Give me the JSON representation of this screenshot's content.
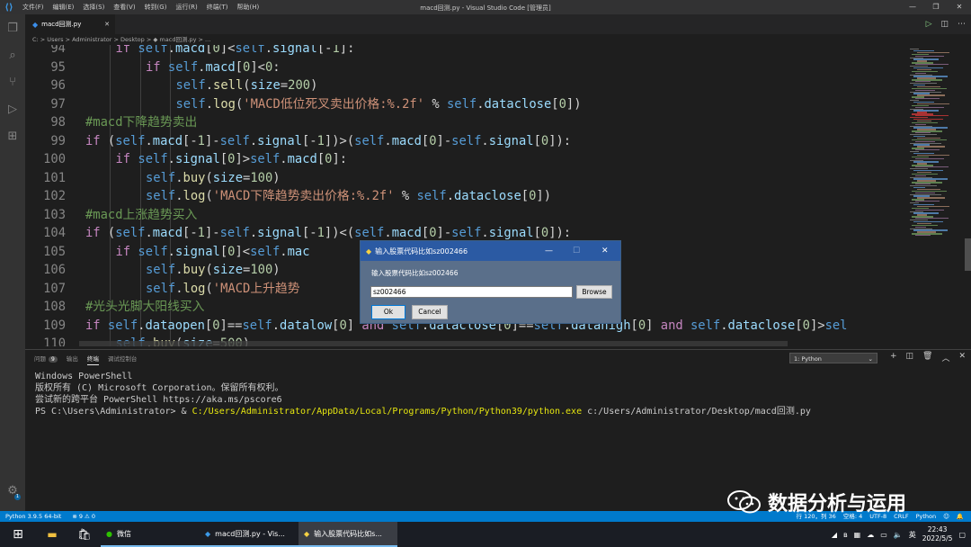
{
  "window": {
    "title": "macd回测.py - Visual Studio Code [管理员]",
    "menu": [
      "文件(F)",
      "编辑(E)",
      "选择(S)",
      "查看(V)",
      "转到(G)",
      "运行(R)",
      "终端(T)",
      "帮助(H)"
    ]
  },
  "tab": {
    "label": "macd回测.py"
  },
  "breadcrumb": "C: > Users > Administrator > Desktop > ◆ macd回测.py > ...",
  "code_lines": [
    {
      "n": "94",
      "indent": 3,
      "tokens": [
        [
          "kw",
          "if "
        ],
        [
          "self",
          "self"
        ],
        [
          "plain",
          "."
        ],
        [
          "param",
          "macd"
        ],
        [
          "plain",
          "["
        ],
        [
          "num",
          "0"
        ],
        [
          "plain",
          "]<"
        ],
        [
          "self",
          "self"
        ],
        [
          "plain",
          "."
        ],
        [
          "param",
          "signal"
        ],
        [
          "plain",
          "[-"
        ],
        [
          "num",
          "1"
        ],
        [
          "plain",
          "]:"
        ]
      ]
    },
    {
      "n": "95",
      "indent": 4,
      "tokens": [
        [
          "kw",
          "if "
        ],
        [
          "self",
          "self"
        ],
        [
          "plain",
          "."
        ],
        [
          "param",
          "macd"
        ],
        [
          "plain",
          "["
        ],
        [
          "num",
          "0"
        ],
        [
          "plain",
          "]<"
        ],
        [
          "num",
          "0"
        ],
        [
          "plain",
          ":"
        ]
      ]
    },
    {
      "n": "96",
      "indent": 5,
      "tokens": [
        [
          "self",
          "self"
        ],
        [
          "plain",
          "."
        ],
        [
          "fn",
          "sell"
        ],
        [
          "plain",
          "("
        ],
        [
          "param",
          "size"
        ],
        [
          "plain",
          "="
        ],
        [
          "num",
          "200"
        ],
        [
          "plain",
          ")"
        ]
      ]
    },
    {
      "n": "97",
      "indent": 5,
      "tokens": [
        [
          "self",
          "self"
        ],
        [
          "plain",
          "."
        ],
        [
          "fn",
          "log"
        ],
        [
          "plain",
          "("
        ],
        [
          "str",
          "'MACD低位死叉卖出价格:%.2f'"
        ],
        [
          "plain",
          " % "
        ],
        [
          "self",
          "self"
        ],
        [
          "plain",
          "."
        ],
        [
          "param",
          "dataclose"
        ],
        [
          "plain",
          "["
        ],
        [
          "num",
          "0"
        ],
        [
          "plain",
          "])"
        ]
      ]
    },
    {
      "n": "98",
      "indent": 2,
      "tokens": [
        [
          "cmt",
          "#macd下降趋势卖出"
        ]
      ]
    },
    {
      "n": "99",
      "indent": 2,
      "tokens": [
        [
          "kw",
          "if "
        ],
        [
          "plain",
          "("
        ],
        [
          "self",
          "self"
        ],
        [
          "plain",
          "."
        ],
        [
          "param",
          "macd"
        ],
        [
          "plain",
          "[-"
        ],
        [
          "num",
          "1"
        ],
        [
          "plain",
          "]-"
        ],
        [
          "self",
          "self"
        ],
        [
          "plain",
          "."
        ],
        [
          "param",
          "signal"
        ],
        [
          "plain",
          "[-"
        ],
        [
          "num",
          "1"
        ],
        [
          "plain",
          "])>("
        ],
        [
          "self",
          "self"
        ],
        [
          "plain",
          "."
        ],
        [
          "param",
          "macd"
        ],
        [
          "plain",
          "["
        ],
        [
          "num",
          "0"
        ],
        [
          "plain",
          "]-"
        ],
        [
          "self",
          "self"
        ],
        [
          "plain",
          "."
        ],
        [
          "param",
          "signal"
        ],
        [
          "plain",
          "["
        ],
        [
          "num",
          "0"
        ],
        [
          "plain",
          "]):"
        ]
      ]
    },
    {
      "n": "100",
      "indent": 3,
      "tokens": [
        [
          "kw",
          "if "
        ],
        [
          "self",
          "self"
        ],
        [
          "plain",
          "."
        ],
        [
          "param",
          "signal"
        ],
        [
          "plain",
          "["
        ],
        [
          "num",
          "0"
        ],
        [
          "plain",
          "]>"
        ],
        [
          "self",
          "self"
        ],
        [
          "plain",
          "."
        ],
        [
          "param",
          "macd"
        ],
        [
          "plain",
          "["
        ],
        [
          "num",
          "0"
        ],
        [
          "plain",
          "]:"
        ]
      ]
    },
    {
      "n": "101",
      "indent": 4,
      "tokens": [
        [
          "self",
          "self"
        ],
        [
          "plain",
          "."
        ],
        [
          "fn",
          "buy"
        ],
        [
          "plain",
          "("
        ],
        [
          "param",
          "size"
        ],
        [
          "plain",
          "="
        ],
        [
          "num",
          "100"
        ],
        [
          "plain",
          ")"
        ]
      ]
    },
    {
      "n": "102",
      "indent": 4,
      "tokens": [
        [
          "self",
          "self"
        ],
        [
          "plain",
          "."
        ],
        [
          "fn",
          "log"
        ],
        [
          "plain",
          "("
        ],
        [
          "str",
          "'MACD下降趋势卖出价格:%.2f'"
        ],
        [
          "plain",
          " % "
        ],
        [
          "self",
          "self"
        ],
        [
          "plain",
          "."
        ],
        [
          "param",
          "dataclose"
        ],
        [
          "plain",
          "["
        ],
        [
          "num",
          "0"
        ],
        [
          "plain",
          "])"
        ]
      ]
    },
    {
      "n": "103",
      "indent": 2,
      "tokens": [
        [
          "cmt",
          "#macd上涨趋势买入"
        ]
      ]
    },
    {
      "n": "104",
      "indent": 2,
      "tokens": [
        [
          "kw",
          "if "
        ],
        [
          "plain",
          "("
        ],
        [
          "self",
          "self"
        ],
        [
          "plain",
          "."
        ],
        [
          "param",
          "macd"
        ],
        [
          "plain",
          "[-"
        ],
        [
          "num",
          "1"
        ],
        [
          "plain",
          "]-"
        ],
        [
          "self",
          "self"
        ],
        [
          "plain",
          "."
        ],
        [
          "param",
          "signal"
        ],
        [
          "plain",
          "[-"
        ],
        [
          "num",
          "1"
        ],
        [
          "plain",
          "])<("
        ],
        [
          "self",
          "self"
        ],
        [
          "plain",
          "."
        ],
        [
          "param",
          "macd"
        ],
        [
          "plain",
          "["
        ],
        [
          "num",
          "0"
        ],
        [
          "plain",
          "]-"
        ],
        [
          "self",
          "self"
        ],
        [
          "plain",
          "."
        ],
        [
          "param",
          "signal"
        ],
        [
          "plain",
          "["
        ],
        [
          "num",
          "0"
        ],
        [
          "plain",
          "]):"
        ]
      ]
    },
    {
      "n": "105",
      "indent": 3,
      "tokens": [
        [
          "kw",
          "if "
        ],
        [
          "self",
          "self"
        ],
        [
          "plain",
          "."
        ],
        [
          "param",
          "signal"
        ],
        [
          "plain",
          "["
        ],
        [
          "num",
          "0"
        ],
        [
          "plain",
          "]<"
        ],
        [
          "self",
          "self"
        ],
        [
          "plain",
          "."
        ],
        [
          "param",
          "mac"
        ]
      ]
    },
    {
      "n": "106",
      "indent": 4,
      "tokens": [
        [
          "self",
          "self"
        ],
        [
          "plain",
          "."
        ],
        [
          "fn",
          "buy"
        ],
        [
          "plain",
          "("
        ],
        [
          "param",
          "size"
        ],
        [
          "plain",
          "="
        ],
        [
          "num",
          "100"
        ],
        [
          "plain",
          ")"
        ]
      ]
    },
    {
      "n": "107",
      "indent": 4,
      "tokens": [
        [
          "self",
          "self"
        ],
        [
          "plain",
          "."
        ],
        [
          "fn",
          "log"
        ],
        [
          "plain",
          "("
        ],
        [
          "str",
          "'MACD上升趋势"
        ]
      ]
    },
    {
      "n": "108",
      "indent": 2,
      "tokens": [
        [
          "cmt",
          "#光头光脚大阳线买入"
        ]
      ]
    },
    {
      "n": "109",
      "indent": 2,
      "tokens": [
        [
          "kw",
          "if "
        ],
        [
          "self",
          "self"
        ],
        [
          "plain",
          "."
        ],
        [
          "param",
          "dataopen"
        ],
        [
          "plain",
          "["
        ],
        [
          "num",
          "0"
        ],
        [
          "plain",
          "]=="
        ],
        [
          "self",
          "self"
        ],
        [
          "plain",
          "."
        ],
        [
          "param",
          "datalow"
        ],
        [
          "plain",
          "["
        ],
        [
          "num",
          "0"
        ],
        [
          "plain",
          "] "
        ],
        [
          "kw",
          "and "
        ],
        [
          "self",
          "self"
        ],
        [
          "plain",
          "."
        ],
        [
          "param",
          "dataclose"
        ],
        [
          "plain",
          "["
        ],
        [
          "num",
          "0"
        ],
        [
          "plain",
          "]=="
        ],
        [
          "self",
          "self"
        ],
        [
          "plain",
          "."
        ],
        [
          "param",
          "datahigh"
        ],
        [
          "plain",
          "["
        ],
        [
          "num",
          "0"
        ],
        [
          "plain",
          "] "
        ],
        [
          "kw",
          "and "
        ],
        [
          "self",
          "self"
        ],
        [
          "plain",
          "."
        ],
        [
          "param",
          "dataclose"
        ],
        [
          "plain",
          "["
        ],
        [
          "num",
          "0"
        ],
        [
          "plain",
          "]>"
        ],
        [
          "self",
          "sel"
        ]
      ]
    },
    {
      "n": "110",
      "indent": 3,
      "tokens": [
        [
          "self",
          "self"
        ],
        [
          "plain",
          "."
        ],
        [
          "fn",
          "buy"
        ],
        [
          "plain",
          "("
        ],
        [
          "param",
          "size"
        ],
        [
          "plain",
          "="
        ],
        [
          "num",
          "500"
        ],
        [
          "plain",
          ")"
        ]
      ]
    }
  ],
  "panel": {
    "tab_problems": "问题",
    "problems_count": "9",
    "tab_output": "输出",
    "tab_terminal": "终端",
    "tab_debug": "调试控制台",
    "terminal_select": "1: Python",
    "terminal_lines": [
      "Windows PowerShell",
      "版权所有 (C) Microsoft Corporation。保留所有权利。",
      "",
      "尝试新的跨平台 PowerShell https://aka.ms/pscore6",
      ""
    ],
    "prompt": "PS C:\\Users\\Administrator> & ",
    "cmd_exe": "C:/Users/Administrator/AppData/Local/Programs/Python/Python39/python.exe",
    "cmd_arg": " c:/Users/Administrator/Desktop/macd回测.py"
  },
  "dialog": {
    "title": "输入股票代码比如sz002466",
    "label": "输入股票代码比如sz002466",
    "input_value": "sz002466",
    "browse": "Browse",
    "ok": "Ok",
    "cancel": "Cancel"
  },
  "status": {
    "python": "Python 3.9.5 64-bit",
    "problems": "⊗ 9 ⚠ 0",
    "position": "行 120，列 36",
    "spaces": "空格: 4",
    "encoding": "UTF-8",
    "eol": "CRLF",
    "language": "Python"
  },
  "taskbar": {
    "wechat": "微信",
    "vscode": "macd回测.py - Vis...",
    "dialog_app": "输入股票代码比如s...",
    "ime": "英",
    "time": "22:43",
    "date": "2022/5/5"
  },
  "watermark": "数据分析与运用",
  "colors": {
    "accent": "#007acc",
    "dialog_title": "#2b5aa3"
  }
}
